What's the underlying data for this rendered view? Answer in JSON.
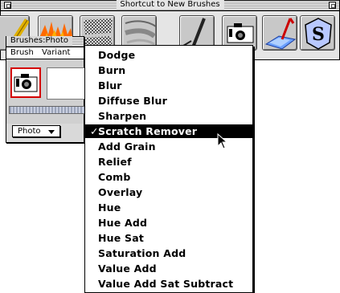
{
  "shortcut_palette": {
    "title": "Shortcut to New Brushes",
    "tools": [
      {
        "icon": "pencil-brush-icon"
      },
      {
        "icon": "fire-brush-icon"
      },
      {
        "icon": "pattern-brush-icon"
      },
      {
        "icon": "eraser-brush-icon"
      },
      {
        "icon": "pen-brush-icon"
      },
      {
        "icon": "camera-brush-icon"
      },
      {
        "icon": "water-brush-icon"
      },
      {
        "icon": "clone-stamp-brush-icon"
      }
    ]
  },
  "brushes_window": {
    "title": "Brushes:Photo",
    "menu_brush": "Brush",
    "menu_variant": "Variant",
    "variant_value": "Photo"
  },
  "variant_menu": {
    "items": [
      "Dodge",
      "Burn",
      "Blur",
      "Diffuse Blur",
      "Sharpen",
      "Scratch Remover",
      "Add Grain",
      "Relief",
      "Comb",
      "Overlay",
      "Hue",
      "Hue Add",
      "Hue Sat",
      "Saturation Add",
      "Value Add",
      "Value Add Sat Subtract"
    ],
    "selected": "Scratch Remover",
    "check_mark": "✓"
  }
}
